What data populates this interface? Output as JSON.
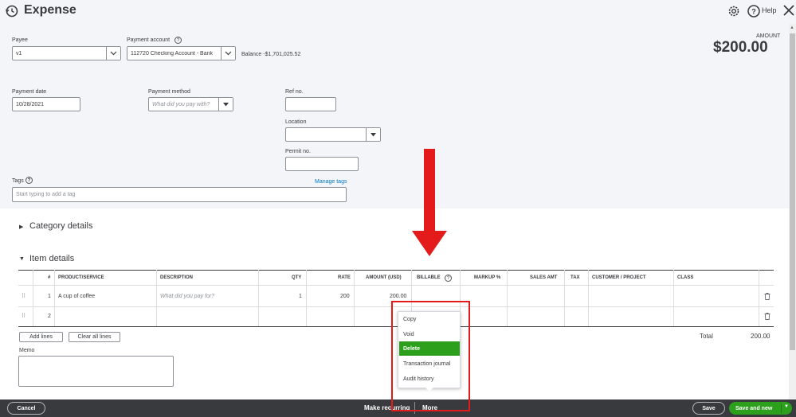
{
  "header": {
    "title": "Expense",
    "help_label": "Help"
  },
  "payee": {
    "label": "Payee",
    "value": "v1"
  },
  "payment_account": {
    "label": "Payment account",
    "value": "112720 Checking Account - Bank",
    "balance": "Balance -$1,701,025.52"
  },
  "amount": {
    "label": "AMOUNT",
    "value": "$200.00"
  },
  "payment_date": {
    "label": "Payment date",
    "value": "10/28/2021"
  },
  "payment_method": {
    "label": "Payment method",
    "placeholder": "What did you pay with?"
  },
  "ref_no": {
    "label": "Ref no.",
    "value": ""
  },
  "location": {
    "label": "Location",
    "value": ""
  },
  "permit_no": {
    "label": "Permit no.",
    "value": ""
  },
  "tags": {
    "label": "Tags",
    "manage_link": "Manage tags",
    "placeholder": "Start typing to add a tag"
  },
  "sections": {
    "category": "Category details",
    "item": "Item details"
  },
  "table": {
    "headers": {
      "num": "#",
      "product": "PRODUCT/SERVICE",
      "description": "DESCRIPTION",
      "qty": "QTY",
      "rate": "RATE",
      "amount": "AMOUNT (USD)",
      "billable": "BILLABLE",
      "markup": "MARKUP %",
      "sales_amt": "SALES AMT",
      "tax": "TAX",
      "customer": "CUSTOMER / PROJECT",
      "class": "CLASS"
    },
    "rows": [
      {
        "num": "1",
        "product": "A cup of coffee",
        "description_placeholder": "What did you pay for?",
        "qty": "1",
        "rate": "200",
        "amount": "200.00"
      },
      {
        "num": "2",
        "product": "",
        "description_placeholder": "",
        "qty": "",
        "rate": "",
        "amount": ""
      }
    ]
  },
  "lines": {
    "add": "Add lines",
    "clear": "Clear all lines"
  },
  "totals": {
    "label": "Total",
    "value": "200.00"
  },
  "memo": {
    "label": "Memo",
    "value": ""
  },
  "more_menu": {
    "items": [
      "Copy",
      "Void",
      "Delete",
      "Transaction journal",
      "Audit history"
    ],
    "active_index": 2
  },
  "footer": {
    "cancel": "Cancel",
    "make_recurring": "Make recurring",
    "more": "More",
    "save": "Save",
    "save_and_new": "Save and new"
  },
  "colors": {
    "accent_green": "#2ca01c",
    "annotation_red": "#e41b1b",
    "link_blue": "#0077c5",
    "footer_bg": "#393a3d"
  }
}
